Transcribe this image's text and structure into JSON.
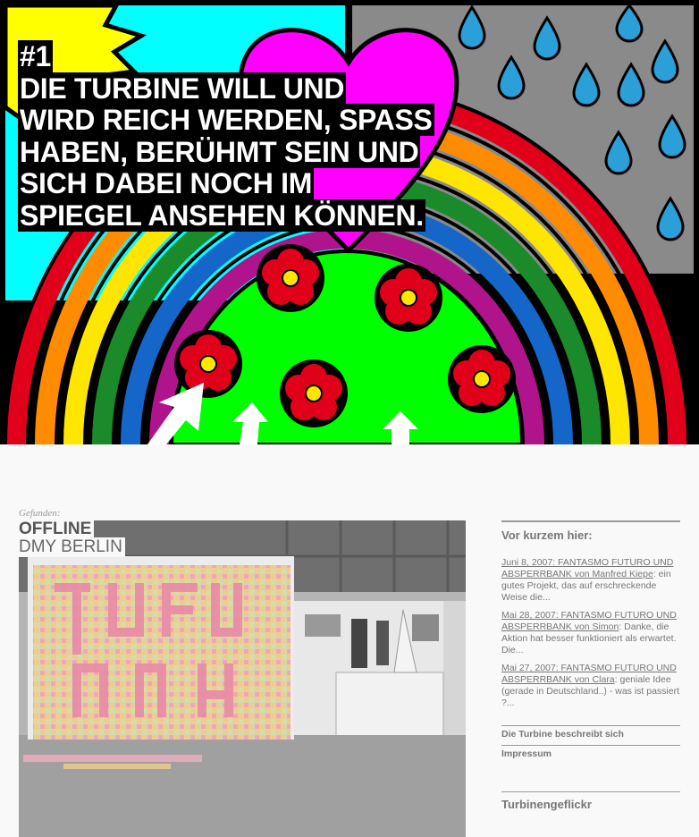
{
  "headline": {
    "number": "#1",
    "lines": [
      "DIE TURBINE WILL UND",
      "WIRD REICH WERDEN, SPASS",
      "HABEN, BERÜHMT SEIN UND",
      "SICH DABEI NOCH IM",
      "SPIEGEL ANSEHEN KÖNNEN."
    ]
  },
  "post": {
    "kicker": "Gefunden:",
    "title_line1": "OFFLINE",
    "title_line2": "DMY BERLIN"
  },
  "sidebar": {
    "recent_heading": "Vor kurzem hier:",
    "comments": [
      {
        "link": "Juni 8, 2007: FANTASMO FUTURO UND ABSPERRBANK von Manfred Kiepe",
        "text": ": ein gutes Projekt, das auf erschreckende Weise die..."
      },
      {
        "link": "Mai 28, 2007: FANTASMO FUTURO UND ABSPERRBANK von Simon",
        "text": ": Danke, die Aktion hat besser funktioniert als erwartet. Die..."
      },
      {
        "link": "Mai 27, 2007: FANTASMO FUTURO UND ABSPERRBANK von Clara",
        "text": ": geniale Idee (gerade in Deutschland..) - was ist passiert ?..."
      }
    ],
    "links": [
      "Die Turbine beschreibt sich",
      "Impressum"
    ],
    "flickr_heading": "Turbinengeflickr"
  },
  "colors": {
    "sky": "#00ffff",
    "rain_grey": "#8a8a8a",
    "drop": "#2a9fd8",
    "heart": "#ff00ff",
    "grass": "#00ff00",
    "flower": "#e0001a",
    "rainbow": [
      "#e0001a",
      "#ff8c00",
      "#ffe600",
      "#1a8a2a",
      "#1466c8",
      "#b0148c"
    ]
  }
}
